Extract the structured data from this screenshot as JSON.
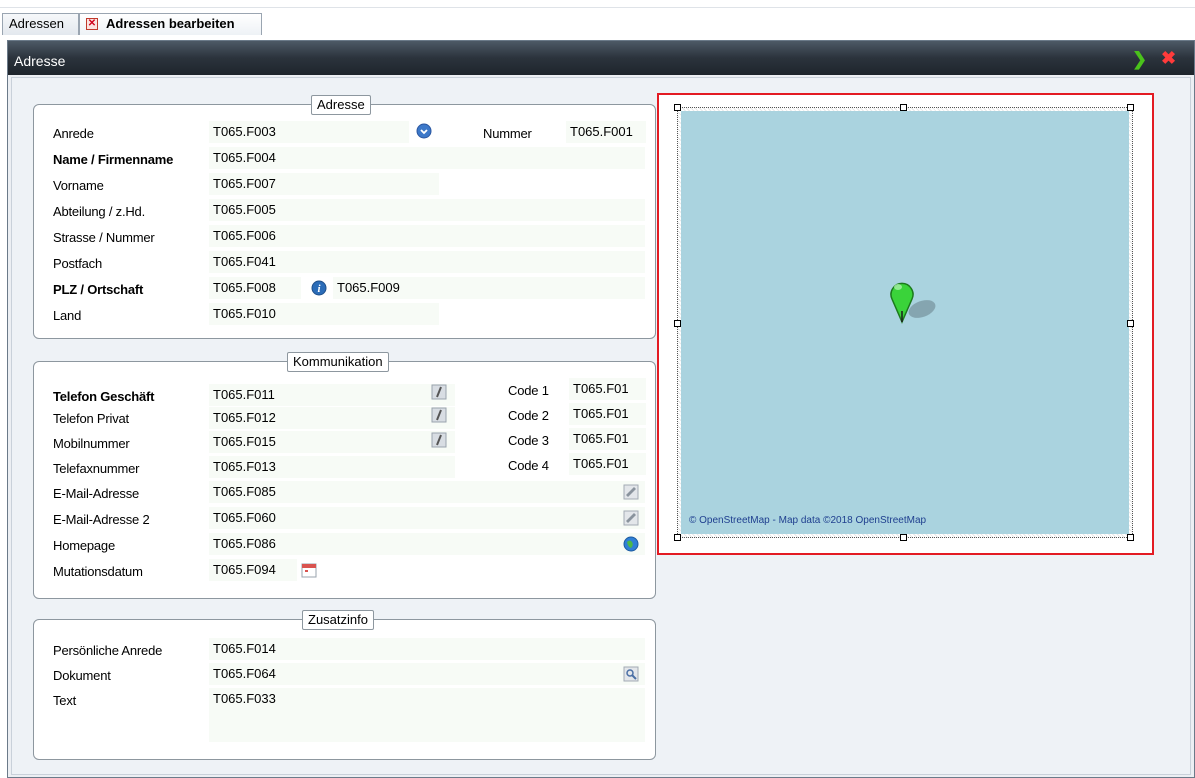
{
  "tabs": [
    {
      "label": "Adressen",
      "active": false
    },
    {
      "label": "Adressen bearbeiten",
      "active": true
    }
  ],
  "window": {
    "title": "Adresse"
  },
  "colors": {
    "accent_red": "#e31b23",
    "title_bar": "#2b333c",
    "map_water": "#aad3df",
    "marker": "#3ad33a"
  },
  "groups": {
    "adresse": {
      "legend": "Adresse",
      "fields": {
        "anrede": {
          "label": "Anrede",
          "value": "T065.F003"
        },
        "nummer": {
          "label": "Nummer",
          "value": "T065.F001"
        },
        "name": {
          "label": "Name / Firmenname",
          "value": "T065.F004"
        },
        "vorname": {
          "label": "Vorname",
          "value": "T065.F007"
        },
        "abteilung": {
          "label": "Abteilung / z.Hd.",
          "value": "T065.F005"
        },
        "strasse": {
          "label": "Strasse / Nummer",
          "value": "T065.F006"
        },
        "postfach": {
          "label": "Postfach",
          "value": "T065.F041"
        },
        "plz": {
          "label": "PLZ / Ortschaft",
          "value": "T065.F008",
          "value2": "T065.F009"
        },
        "land": {
          "label": "Land",
          "value": "T065.F010"
        }
      }
    },
    "kommunikation": {
      "legend": "Kommunikation",
      "fields": {
        "tel_geschaeft": {
          "label": "Telefon Geschäft",
          "value": "T065.F011"
        },
        "tel_privat": {
          "label": "Telefon Privat",
          "value": "T065.F012"
        },
        "mobil": {
          "label": "Mobilnummer",
          "value": "T065.F015"
        },
        "fax": {
          "label": "Telefaxnummer",
          "value": "T065.F013"
        },
        "email": {
          "label": "E-Mail-Adresse",
          "value": "T065.F085"
        },
        "email2": {
          "label": "E-Mail-Adresse 2",
          "value": "T065.F060"
        },
        "homepage": {
          "label": "Homepage",
          "value": "T065.F086"
        },
        "mutation": {
          "label": "Mutationsdatum",
          "value": "T065.F094"
        },
        "code1": {
          "label": "Code 1",
          "value": "T065.F01"
        },
        "code2": {
          "label": "Code 2",
          "value": "T065.F01"
        },
        "code3": {
          "label": "Code 3",
          "value": "T065.F01"
        },
        "code4": {
          "label": "Code 4",
          "value": "T065.F01"
        }
      }
    },
    "zusatzinfo": {
      "legend": "Zusatzinfo",
      "fields": {
        "pers_anrede": {
          "label": "Persönliche Anrede",
          "value": "T065.F014"
        },
        "dokument": {
          "label": "Dokument",
          "value": "T065.F064"
        },
        "text": {
          "label": "Text",
          "value": "T065.F033"
        }
      }
    }
  },
  "map": {
    "attribution": "© OpenStreetMap - Map data ©2018 OpenStreetMap"
  },
  "icons": [
    "close-icon",
    "accept-arrow-icon",
    "dropdown-circle-icon",
    "info-icon",
    "phone-icon",
    "email-icon",
    "globe-icon",
    "calendar-icon",
    "search-icon",
    "map-marker-icon"
  ]
}
